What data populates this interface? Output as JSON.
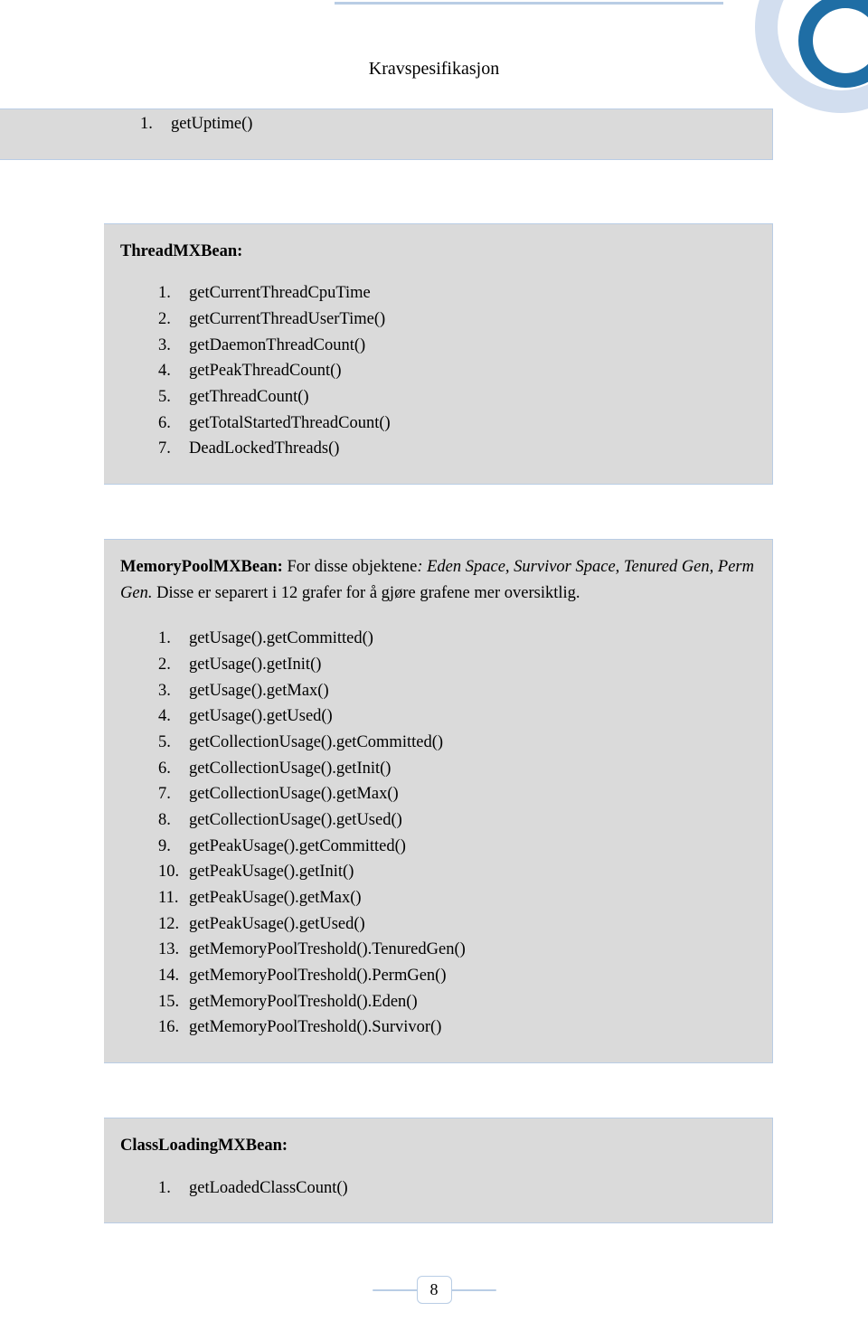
{
  "header": {
    "title": "Kravspesifikasjon"
  },
  "sections": [
    {
      "title_bold": "",
      "title_desc": "",
      "items": [
        "getUptime()"
      ]
    },
    {
      "title_bold": "ThreadMXBean:",
      "title_desc": "",
      "items": [
        "getCurrentThreadCpuTime",
        "getCurrentThreadUserTime()",
        "getDaemonThreadCount()",
        "getPeakThreadCount()",
        "getThreadCount()",
        "getTotalStartedThreadCount()",
        "DeadLockedThreads()"
      ]
    },
    {
      "title_bold": "MemoryPoolMXBean:",
      "title_normal": " For disse objektene",
      "title_italic": ": Eden Space, Survivor Space, Tenured Gen, Perm Gen.",
      "title_after_italic": " Disse er separert i 12 grafer for å gjøre grafene mer oversiktlig.",
      "items": [
        "getUsage().getCommitted()",
        "getUsage().getInit()",
        "getUsage().getMax()",
        "getUsage().getUsed()",
        "getCollectionUsage().getCommitted()",
        "getCollectionUsage().getInit()",
        "getCollectionUsage().getMax()",
        "getCollectionUsage().getUsed()",
        "getPeakUsage().getCommitted()",
        "getPeakUsage().getInit()",
        "getPeakUsage().getMax()",
        "getPeakUsage().getUsed()",
        "getMemoryPoolTreshold().TenuredGen()",
        "getMemoryPoolTreshold().PermGen()",
        "getMemoryPoolTreshold().Eden()",
        "getMemoryPoolTreshold().Survivor()"
      ]
    },
    {
      "title_bold": "ClassLoadingMXBean:",
      "title_desc": "",
      "items": [
        "getLoadedClassCount()"
      ]
    }
  ],
  "pageNumber": "8"
}
